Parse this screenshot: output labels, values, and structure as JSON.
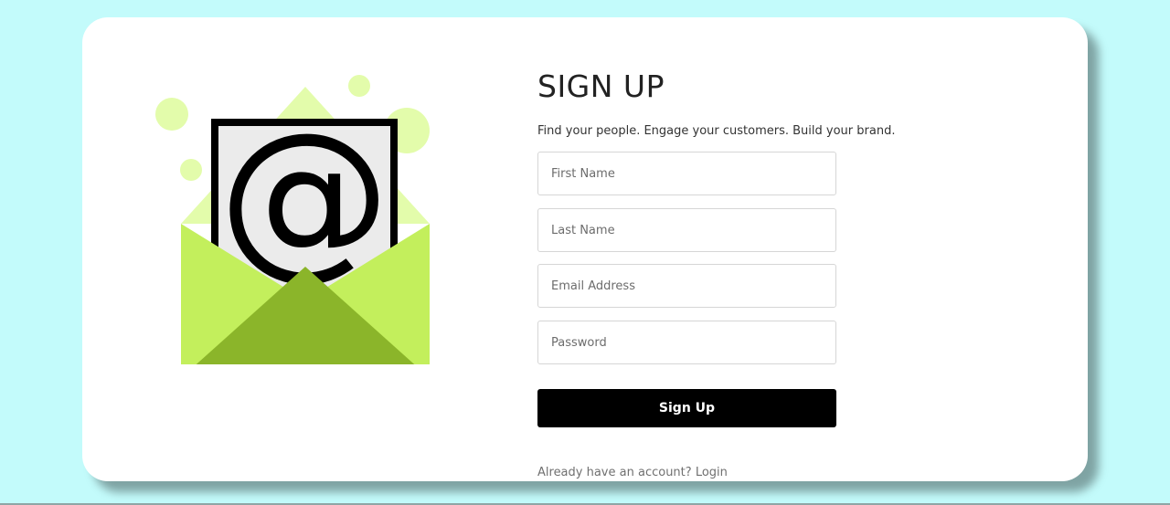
{
  "signup": {
    "title": "SIGN UP",
    "subtitle": "Find your people. Engage your customers. Build your brand.",
    "fields": {
      "first_name": {
        "placeholder": "First Name",
        "value": ""
      },
      "last_name": {
        "placeholder": "Last Name",
        "value": ""
      },
      "email": {
        "placeholder": "Email Address",
        "value": ""
      },
      "password": {
        "placeholder": "Password",
        "value": ""
      }
    },
    "submit_label": "Sign Up",
    "login_prompt": "Already have an account?",
    "login_link": "Login"
  },
  "illustration": {
    "icon": "envelope-at-icon",
    "symbol": "@"
  },
  "colors": {
    "page_background": "#c3fbfb",
    "card_background": "#ffffff",
    "envelope_light": "#c3ef5c",
    "envelope_dark": "#8bb52a",
    "envelope_back": "#e3fcab",
    "button_background": "#000000"
  }
}
